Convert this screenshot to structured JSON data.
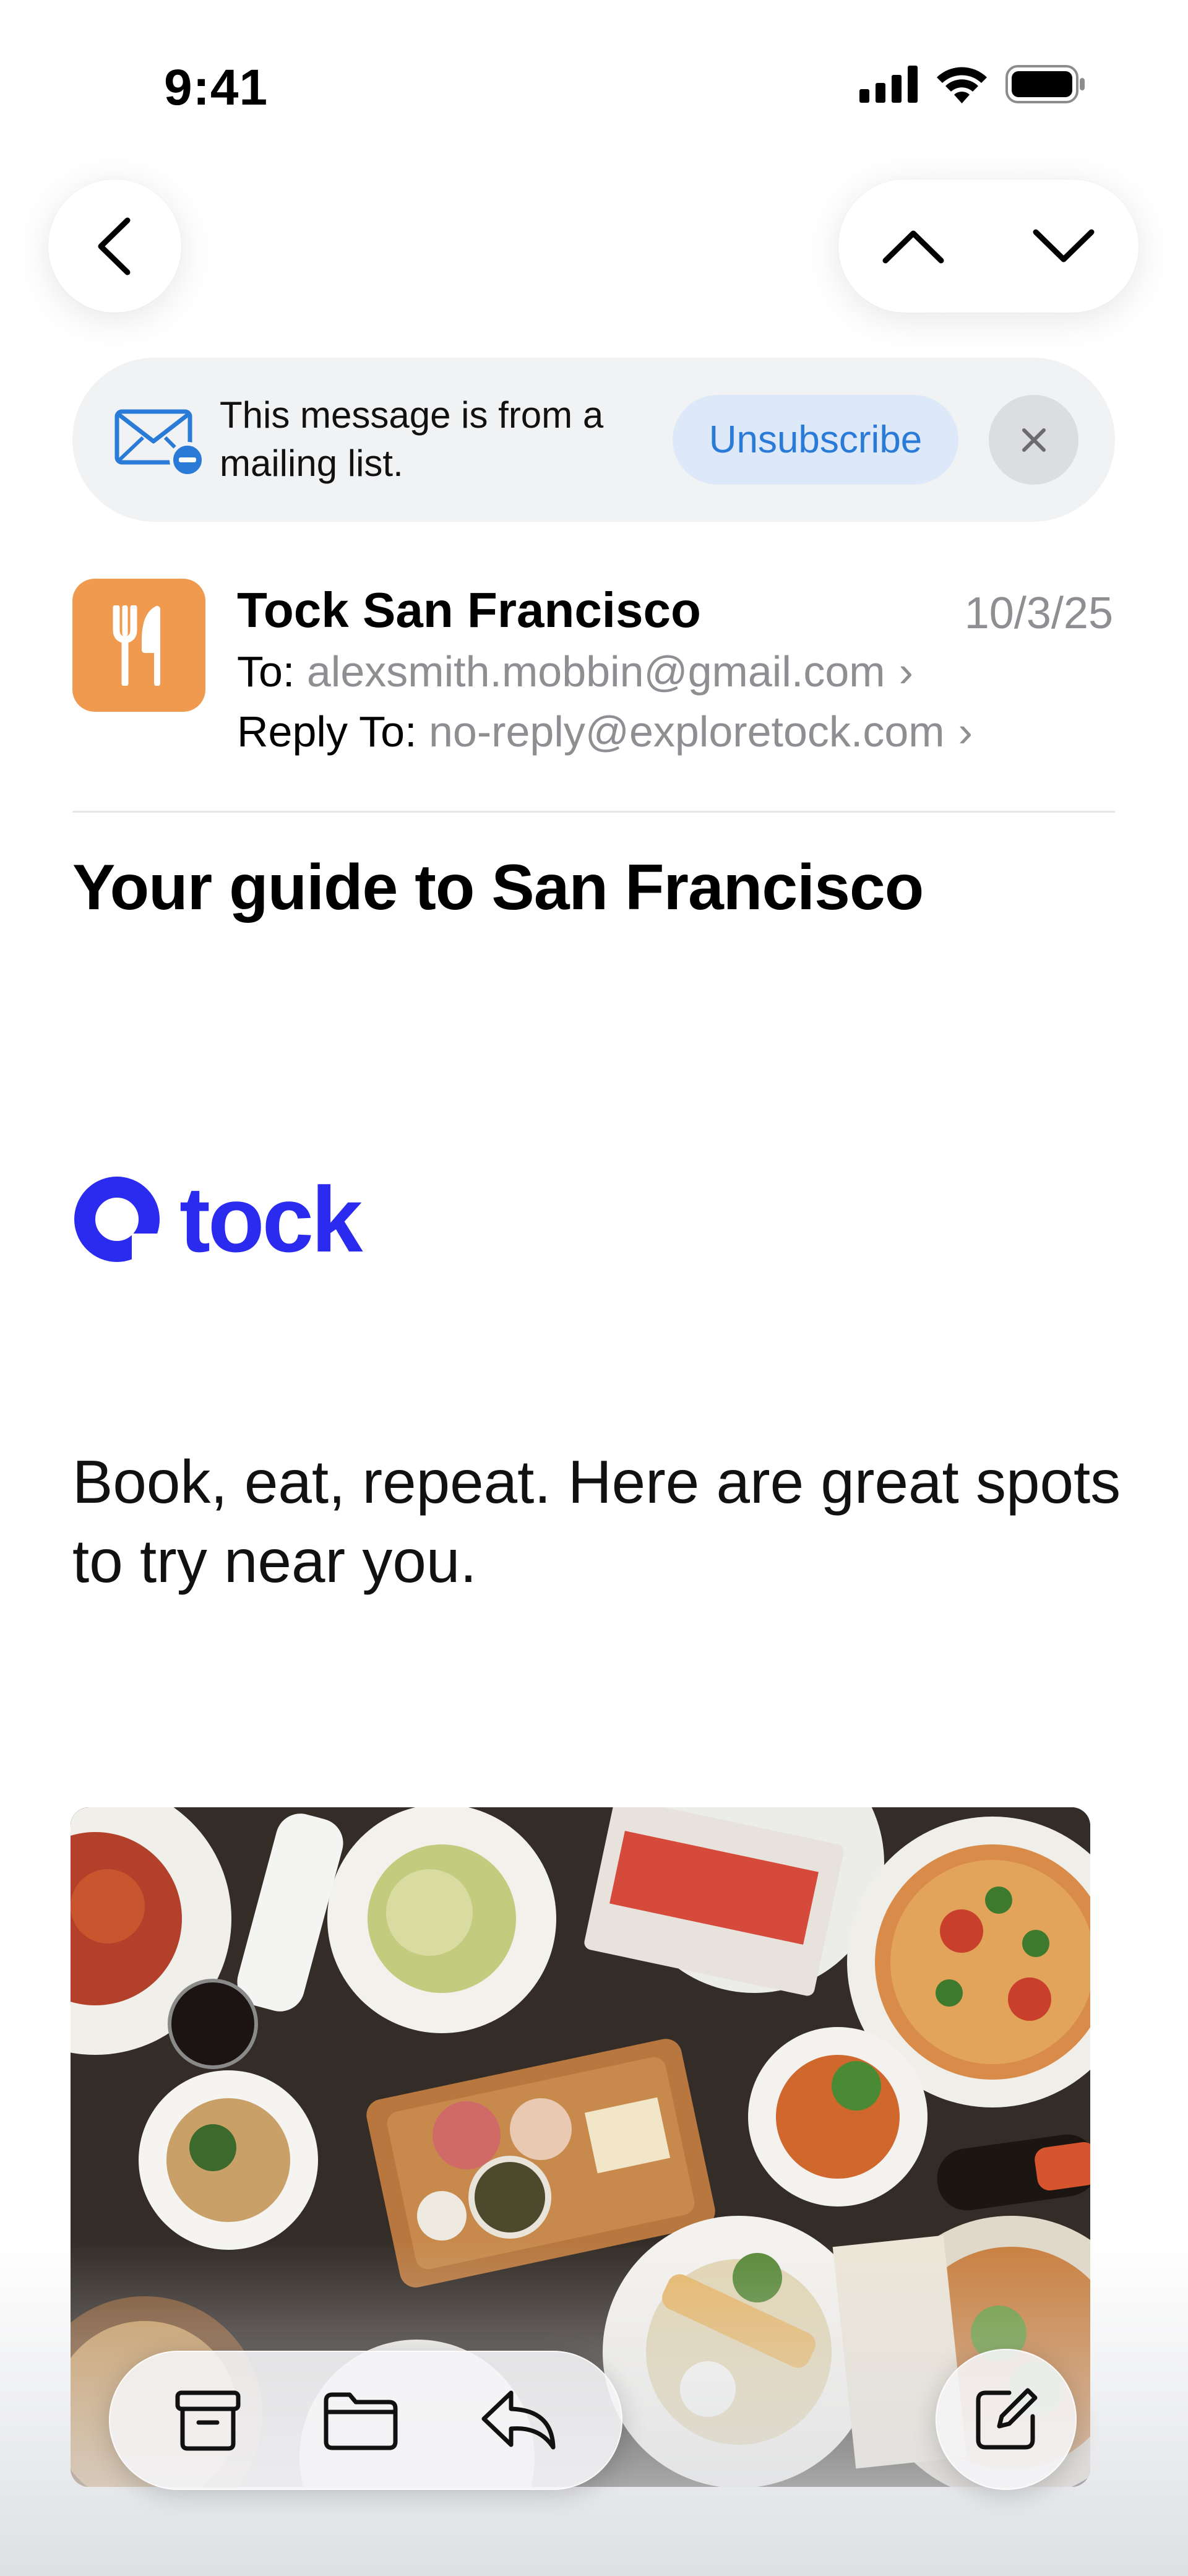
{
  "status_bar": {
    "time": "9:41"
  },
  "banner": {
    "message": "This message is from a mailing list.",
    "unsubscribe_label": "Unsubscribe"
  },
  "email": {
    "sender": "Tock San Francisco",
    "date": "10/3/25",
    "to_label": "To:",
    "to_address": "alexsmith.mobbin@gmail.com",
    "reply_to_label": "Reply To:",
    "reply_to_address": "no-reply@exploretock.com",
    "subject": "Your guide to San Francisco"
  },
  "body": {
    "logo_text": "tock",
    "tagline": "Book, eat, repeat. Here are great spots to try near you."
  },
  "colors": {
    "accent_blue": "#2a7ad8",
    "brand_tock": "#2b2bf0",
    "sender_avatar": "#ef9a4e"
  },
  "icons": {
    "back": "chevron-left-icon",
    "prev": "chevron-up-icon",
    "next": "chevron-down-icon",
    "mailing_list": "envelope-minus-icon",
    "close": "close-icon",
    "avatar": "fork-knife-icon",
    "archive": "archive-box-icon",
    "move": "folder-icon",
    "reply": "reply-arrow-icon",
    "compose": "compose-icon"
  }
}
